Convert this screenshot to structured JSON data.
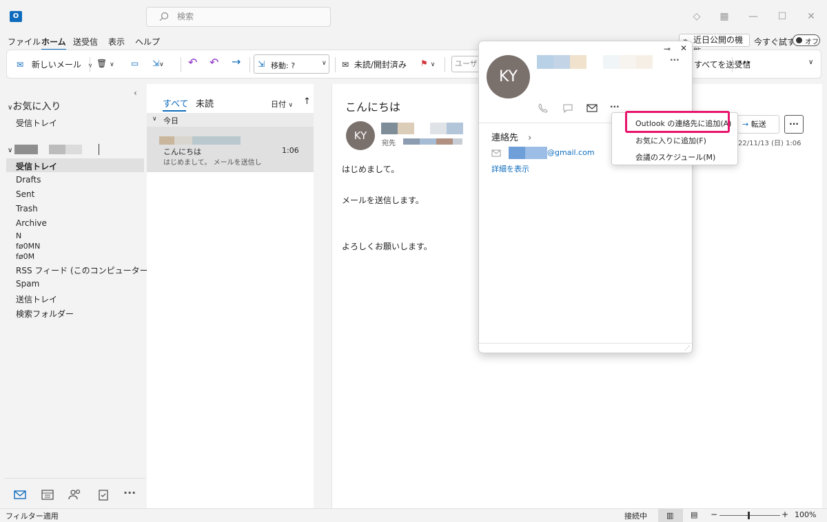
{
  "app": {
    "icon_label": "O"
  },
  "search": {
    "placeholder": "検索"
  },
  "menubar": {
    "items": [
      "ファイル",
      "ホーム",
      "送受信",
      "表示",
      "ヘルプ"
    ],
    "coming_soon": "近日公開の機能",
    "try_now": "今すぐ試す",
    "toggle_label": "オフ"
  },
  "ribbon": {
    "new_mail": "新しいメール",
    "move_label": "移動: ?",
    "read_unread": "未読/開封済み",
    "user_field": "ユーザー",
    "send_receive": "すべてを送受信",
    "more": "···"
  },
  "folders": {
    "favorites": "お気に入り",
    "favorites_inbox": "受信トレイ",
    "account_items": [
      "受信トレイ",
      "Drafts",
      "Sent",
      "Trash",
      "Archive",
      "N",
      "fø0MN",
      "fø0M",
      "RSS フィード (このコンピューターのみ)",
      "Spam",
      "送信トレイ",
      "検索フォルダー"
    ]
  },
  "list": {
    "tab_all": "すべて",
    "tab_unread": "未読",
    "sort_label": "日付",
    "group_today": "今日",
    "message": {
      "subject": "こんにちは",
      "preview": "はじめまして。 メールを送信し",
      "time": "1:06"
    }
  },
  "reading": {
    "subject": "こんにちは",
    "avatar_initials": "KY",
    "to_label": "宛先",
    "date": "22/11/13 (日) 1:06",
    "forward": "転送",
    "body": [
      "はじめまして。",
      "メールを送信します。",
      "よろしくお願いします。"
    ]
  },
  "card": {
    "initials": "KY",
    "contact_header": "連絡先",
    "email_domain": "@gmail.com",
    "show_details": "詳細を表示"
  },
  "context_menu": {
    "items": [
      "Outlook の連絡先に追加(A)",
      "お気に入りに追加(F)",
      "会議のスケジュール(M)"
    ]
  },
  "status": {
    "filter": "フィルター適用",
    "connection": "接続中",
    "zoom": "100%"
  },
  "colors": {
    "accent": "#0f6cbd",
    "highlight": "#e8136b",
    "avatar": "#7a706c"
  }
}
